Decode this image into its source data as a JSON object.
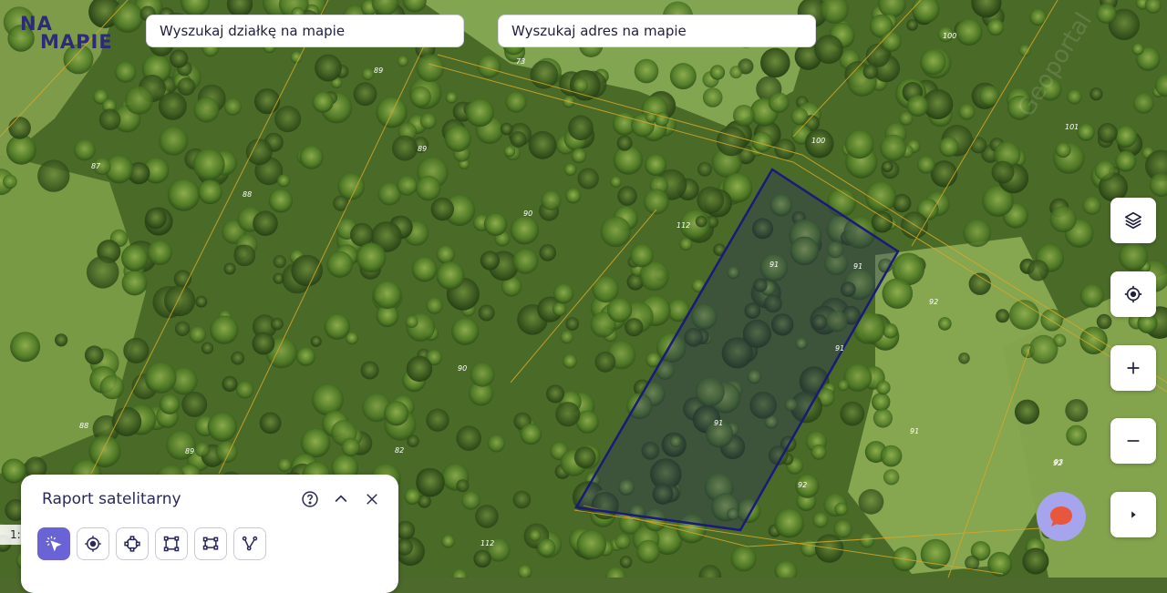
{
  "logo": {
    "line1": "NA",
    "line2": "MAPIE"
  },
  "search": {
    "parcel_placeholder": "Wyszukaj działkę na mapie",
    "address_placeholder": "Wyszukaj adres na mapie"
  },
  "map": {
    "parcel_numbers": [
      "73",
      "89",
      "100",
      "100",
      "101",
      "87",
      "88",
      "89",
      "90",
      "112",
      "91",
      "91",
      "92",
      "91",
      "91",
      "90",
      "88",
      "89",
      "82",
      "91",
      "92",
      "92",
      "93",
      "112"
    ],
    "watermark": "Geoportal",
    "selected_parcel_color": "#1a1a7a",
    "boundary_color": "#d4a928"
  },
  "controls": {
    "layers": "layers-icon",
    "locate": "locate-icon",
    "zoom_in": "plus-icon",
    "zoom_out": "minus-icon",
    "expand": "play-icon"
  },
  "chat": {
    "icon": "chat-icon",
    "color": "#a7a4ee"
  },
  "panel": {
    "title": "Raport satelitarny",
    "tools": [
      "select-tool-icon",
      "point-tool-icon",
      "circle-tool-icon",
      "rectangle-tool-icon",
      "polygon-tool-icon",
      "line-tool-icon"
    ],
    "active_tool": 0,
    "accent": "#6a63d6"
  },
  "scale": {
    "label": "1:"
  }
}
